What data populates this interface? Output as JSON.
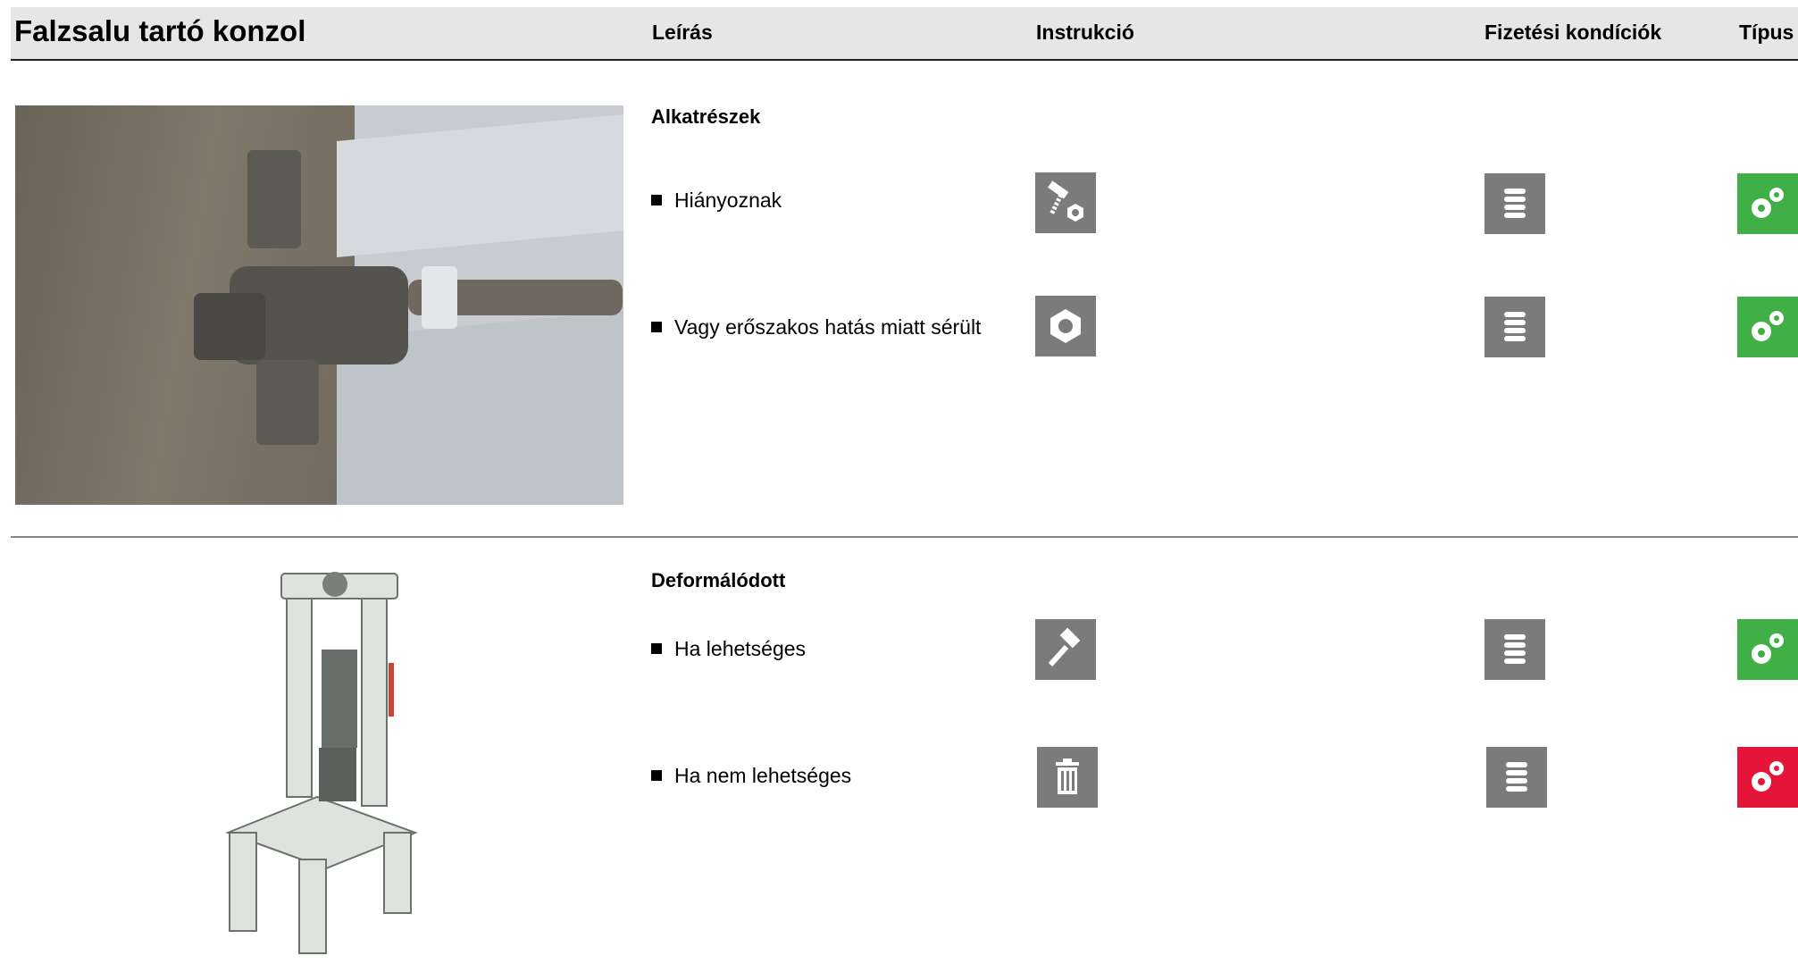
{
  "header": {
    "title": "Falzsalu tartó konzol",
    "col_description": "Leírás",
    "col_instruction": "Instrukció",
    "col_payment": "Fizetési kondíciók",
    "col_type": "Típus"
  },
  "sections": [
    {
      "title": "Alkatrészek",
      "items": [
        {
          "label": "Hiányoznak",
          "instruction_icon": "bolt-nut-icon",
          "payment_icon": "coin-stack-icon",
          "type_icon": "gears-icon",
          "type_color": "#3faf46"
        },
        {
          "label": "Vagy erőszakos hatás miatt sérült",
          "instruction_icon": "hex-nut-icon",
          "payment_icon": "coin-stack-icon",
          "type_icon": "gears-icon",
          "type_color": "#3faf46"
        }
      ]
    },
    {
      "title": "Deformálódott",
      "items": [
        {
          "label": "Ha lehetséges",
          "instruction_icon": "hammer-icon",
          "payment_icon": "coin-stack-icon",
          "type_icon": "gears-icon",
          "type_color": "#3faf46"
        },
        {
          "label": "Ha nem lehetséges",
          "instruction_icon": "trash-icon",
          "payment_icon": "coin-stack-icon",
          "type_icon": "gears-icon",
          "type_color": "#e5153a"
        }
      ]
    }
  ],
  "colors": {
    "header_bg": "#e6e6e6",
    "icon_gray": "#7b7b7b",
    "ok_green": "#3faf46",
    "scrap_red": "#e5153a"
  }
}
